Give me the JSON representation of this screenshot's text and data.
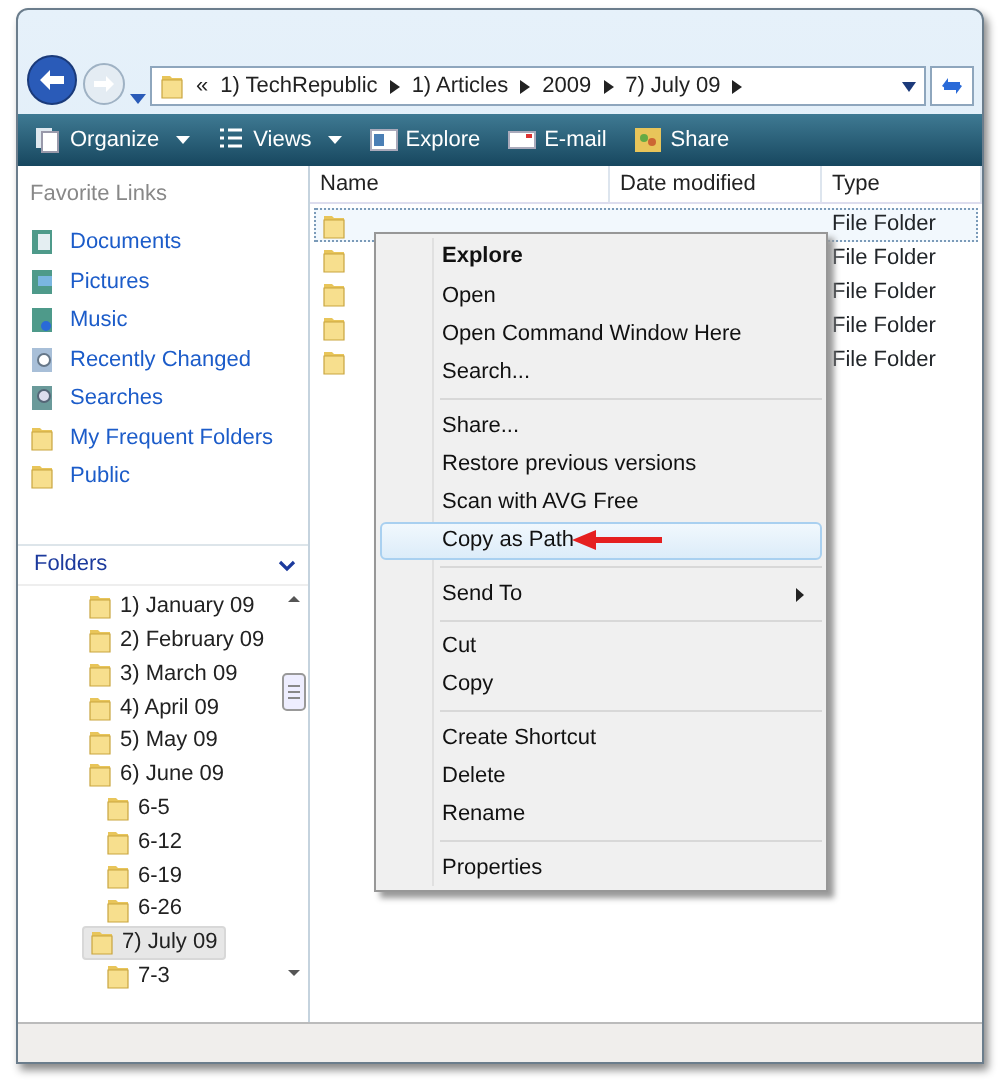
{
  "address_bar": {
    "overflow": "«",
    "crumbs": [
      "1) TechRepublic",
      "1) Articles",
      "2009",
      "7) July 09"
    ]
  },
  "toolbar": [
    {
      "label": "Organize",
      "dropdown": true
    },
    {
      "label": "Views",
      "dropdown": true
    },
    {
      "label": "Explore",
      "dropdown": false
    },
    {
      "label": "E-mail",
      "dropdown": false
    },
    {
      "label": "Share",
      "dropdown": false
    }
  ],
  "favorite_links": {
    "title": "Favorite Links",
    "items": [
      {
        "label": "Documents"
      },
      {
        "label": "Pictures"
      },
      {
        "label": "Music"
      },
      {
        "label": "Recently Changed"
      },
      {
        "label": "Searches"
      },
      {
        "label": "My Frequent Folders"
      },
      {
        "label": "Public"
      }
    ]
  },
  "folders": {
    "title": "Folders",
    "expanded": true,
    "tree": [
      {
        "label": "1) January 09",
        "selected": false
      },
      {
        "label": "2) February 09",
        "selected": false
      },
      {
        "label": "3) March 09",
        "selected": false
      },
      {
        "label": "4) April 09",
        "selected": false
      },
      {
        "label": "5) May 09",
        "selected": false
      },
      {
        "label": "6) June 09",
        "selected": false,
        "children": [
          {
            "label": "6-5",
            "selected": false
          },
          {
            "label": "6-12",
            "selected": false
          },
          {
            "label": "6-19",
            "selected": false
          },
          {
            "label": "6-26",
            "selected": false
          }
        ]
      },
      {
        "label": "7) July 09",
        "selected": true,
        "children": [
          {
            "label": "7-3",
            "selected": false
          }
        ]
      }
    ]
  },
  "file_list": {
    "columns": [
      "Name",
      "Date modified",
      "Type"
    ],
    "rows": [
      {
        "type": "File Folder",
        "selected": true
      },
      {
        "type": "File Folder",
        "selected": false
      },
      {
        "type": "File Folder",
        "selected": false
      },
      {
        "type": "File Folder",
        "selected": false
      },
      {
        "type": "File Folder",
        "selected": false
      }
    ]
  },
  "context_menu": [
    {
      "kind": "item",
      "label": "Explore",
      "default": true,
      "selected": false
    },
    {
      "kind": "item",
      "label": "Open",
      "default": false,
      "selected": false
    },
    {
      "kind": "item",
      "label": "Open Command Window Here",
      "default": false,
      "selected": false
    },
    {
      "kind": "item",
      "label": "Search...",
      "default": false,
      "selected": false
    },
    {
      "kind": "separator"
    },
    {
      "kind": "item",
      "label": "Share...",
      "default": false,
      "selected": false
    },
    {
      "kind": "item",
      "label": "Restore previous versions",
      "default": false,
      "selected": false
    },
    {
      "kind": "item",
      "label": "Scan with AVG Free",
      "default": false,
      "selected": false
    },
    {
      "kind": "item",
      "label": "Copy as Path",
      "default": false,
      "selected": true,
      "annotated": true
    },
    {
      "kind": "separator"
    },
    {
      "kind": "submenu",
      "label": "Send To",
      "default": false,
      "selected": false
    },
    {
      "kind": "separator"
    },
    {
      "kind": "item",
      "label": "Cut",
      "default": false,
      "selected": false
    },
    {
      "kind": "item",
      "label": "Copy",
      "default": false,
      "selected": false
    },
    {
      "kind": "separator"
    },
    {
      "kind": "item",
      "label": "Create Shortcut",
      "default": false,
      "selected": false
    },
    {
      "kind": "item",
      "label": "Delete",
      "default": false,
      "selected": false
    },
    {
      "kind": "item",
      "label": "Rename",
      "default": false,
      "selected": false
    },
    {
      "kind": "separator"
    },
    {
      "kind": "item",
      "label": "Properties",
      "default": false,
      "selected": false
    }
  ]
}
